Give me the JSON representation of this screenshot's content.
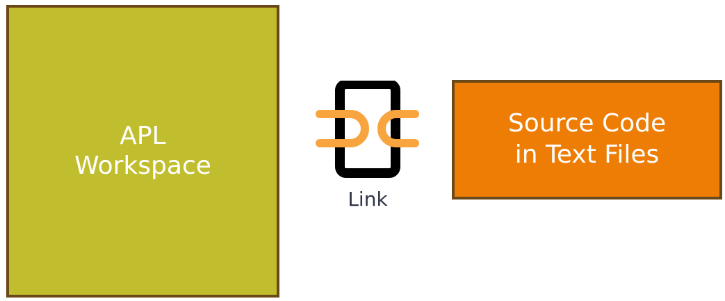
{
  "diagram": {
    "workspace": {
      "line1": "APL",
      "line2": "Workspace"
    },
    "source": {
      "line1": "Source Code",
      "line2": "in Text Files"
    },
    "link": {
      "label": "Link"
    }
  },
  "colors": {
    "workspace_fill": "#c0bd2f",
    "source_fill": "#ed7d05",
    "border": "#6b4818",
    "link_accent": "#f8a540",
    "link_frame": "#000000",
    "label_text": "#2f3446"
  }
}
